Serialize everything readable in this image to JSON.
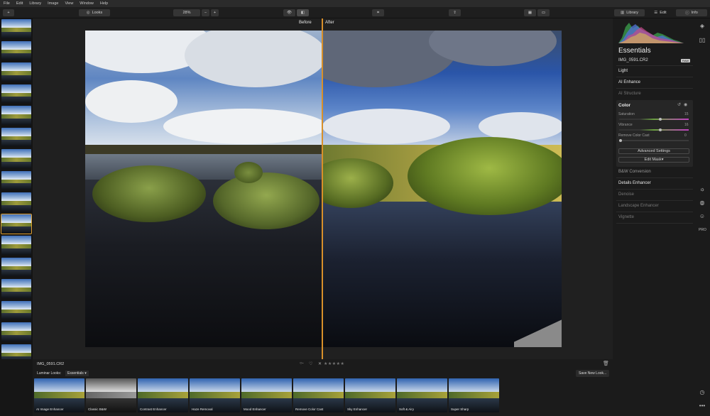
{
  "menu": [
    "File",
    "Edit",
    "Library",
    "Image",
    "View",
    "Window",
    "Help"
  ],
  "toolbar": {
    "add_label": "+",
    "looks_label": "Looks",
    "zoom_value": "28%",
    "zoom_out": "−",
    "zoom_in": "+"
  },
  "tabs": {
    "library": "Library",
    "edit": "Edit",
    "info": "Info"
  },
  "canvas": {
    "before_label": "Before",
    "after_label": "After"
  },
  "bottom": {
    "filename": "IMG_0591.CR2",
    "looks_label": "Luminar Looks:",
    "looks_category": "Essentials",
    "save_look": "Save New Look...",
    "rating": "★★★★★",
    "looks": [
      "AI Image Enhancer",
      "Classic B&W",
      "Contrast Enhancer",
      "Haze Removal",
      "Mood Enhancer",
      "Remove Color Cast",
      "Sky Enhancer",
      "Soft & Airy",
      "Super Sharp"
    ]
  },
  "panel": {
    "title": "Essentials",
    "filename": "IMG_0591.CR2",
    "raw_badge": "RAW",
    "sections_top": [
      "Light",
      "AI Enhance",
      "AI Structure"
    ],
    "color": {
      "title": "Color",
      "saturation_label": "Saturation",
      "saturation_value": "15",
      "saturation_level": 0.6,
      "vibrance_label": "Vibrance",
      "vibrance_value": "16",
      "vibrance_level": 0.6,
      "remove_cast_label": "Remove Color Cast",
      "remove_cast_value": "0",
      "remove_cast_level": 0,
      "advanced": "Advanced Settings",
      "edit_mask": "Edit Mask"
    },
    "sections_bottom": [
      "B&W Conversion",
      "Details Enhancer",
      "Denoise",
      "Landscape Enhancer",
      "Vignette"
    ]
  },
  "icons": [
    "layers-icon",
    "compare-icon",
    "sun-icon",
    "palette-icon",
    "face-icon",
    "pro-icon",
    "history-icon",
    "more-icon"
  ]
}
